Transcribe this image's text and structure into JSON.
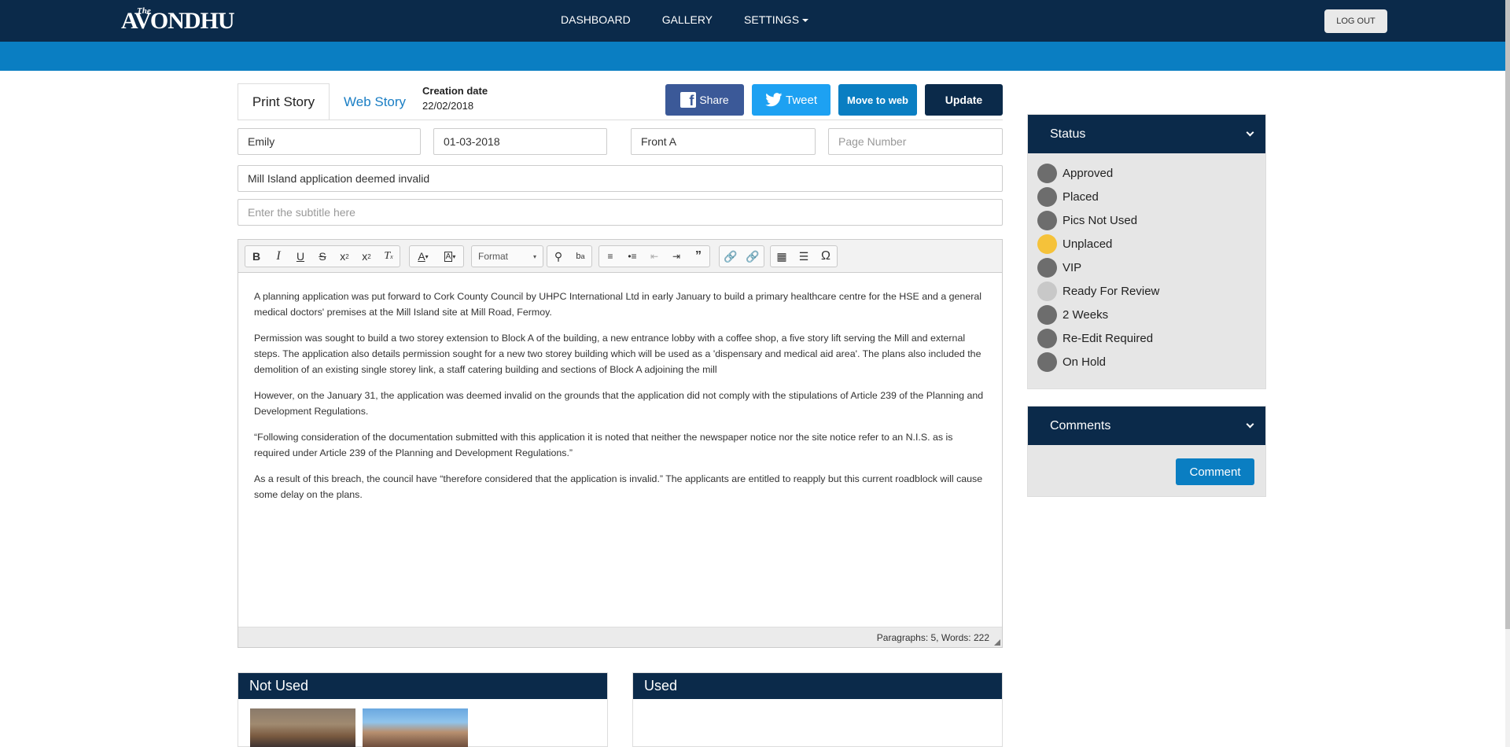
{
  "brand": {
    "the": "The",
    "name": "AVONDHU"
  },
  "nav": {
    "dashboard": "DASHBOARD",
    "gallery": "GALLERY",
    "settings": "SETTINGS",
    "logout": "LOG OUT"
  },
  "tabs": {
    "print": "Print Story",
    "web": "Web Story"
  },
  "creation": {
    "label": "Creation date",
    "value": "22/02/2018"
  },
  "actions": {
    "share": "Share",
    "tweet": "Tweet",
    "move": "Move to web",
    "update": "Update"
  },
  "fields": {
    "author": "Emily",
    "date": "01-03-2018",
    "section": "Front A",
    "page_placeholder": "Page Number",
    "title": "Mill Island application deemed invalid",
    "subtitle_placeholder": "Enter the subtitle here"
  },
  "toolbar": {
    "format": "Format",
    "icons": [
      "bold-icon",
      "italic-icon",
      "underline-icon",
      "strikethrough-icon",
      "subscript-icon",
      "superscript-icon",
      "remove-format-icon",
      "text-color-icon",
      "bg-color-icon",
      "find-icon",
      "replace-icon",
      "numbered-list-icon",
      "bulleted-list-icon",
      "outdent-icon",
      "indent-icon",
      "blockquote-icon",
      "link-icon",
      "unlink-icon",
      "table-icon",
      "horizontal-rule-icon",
      "special-char-icon"
    ]
  },
  "body": {
    "p1": "A planning application was put forward to Cork County Council by UHPC International Ltd in early January to build a primary healthcare centre for the HSE and a general medical doctors' premises at the Mill Island site at Mill Road, Fermoy.",
    "p2": "Permission was sought to build a two storey extension to Block A of the building, a new entrance lobby with a coffee shop, a five story lift serving the Mill and external steps. The application also details permission sought for a new two storey building which will be used as a 'dispensary and medical aid area'. The plans also included the demolition of an existing single storey link, a staff catering building and sections of Block A adjoining the mill",
    "p3": "However, on the January 31, the application was deemed invalid on the grounds that the application did not comply with the stipulations of Article 239 of the Planning and Development Regulations.",
    "p4": "“Following consideration of the documentation submitted with this application it is noted that neither the newspaper notice nor the site notice refer to an N.I.S.  as is required under Article 239 of the Planning and Development Regulations.”",
    "p5": "As a result of this breach, the council have “therefore considered that the application is invalid.” The applicants are entitled to reapply but this current roadblock will cause some delay on the plans."
  },
  "editor_status": "Paragraphs: 5, Words: 222",
  "panels": {
    "not_used": "Not Used",
    "used": "Used"
  },
  "status_panel": {
    "title": "Status",
    "items": [
      {
        "label": "Approved",
        "color": "#6d6d6d"
      },
      {
        "label": "Placed",
        "color": "#6d6d6d"
      },
      {
        "label": "Pics Not Used",
        "color": "#6d6d6d"
      },
      {
        "label": "Unplaced",
        "color": "#f5c23a"
      },
      {
        "label": "VIP",
        "color": "#6d6d6d"
      },
      {
        "label": "Ready For Review",
        "color": "#c8c8c8"
      },
      {
        "label": "2 Weeks",
        "color": "#6d6d6d"
      },
      {
        "label": "Re-Edit Required",
        "color": "#6d6d6d"
      },
      {
        "label": "On Hold",
        "color": "#6d6d6d"
      }
    ]
  },
  "comments_panel": {
    "title": "Comments",
    "button": "Comment"
  },
  "colors": {
    "navy": "#0b2a4a",
    "accent": "#0a7ec2",
    "facebook": "#3b5998",
    "twitter": "#1da1f2"
  }
}
